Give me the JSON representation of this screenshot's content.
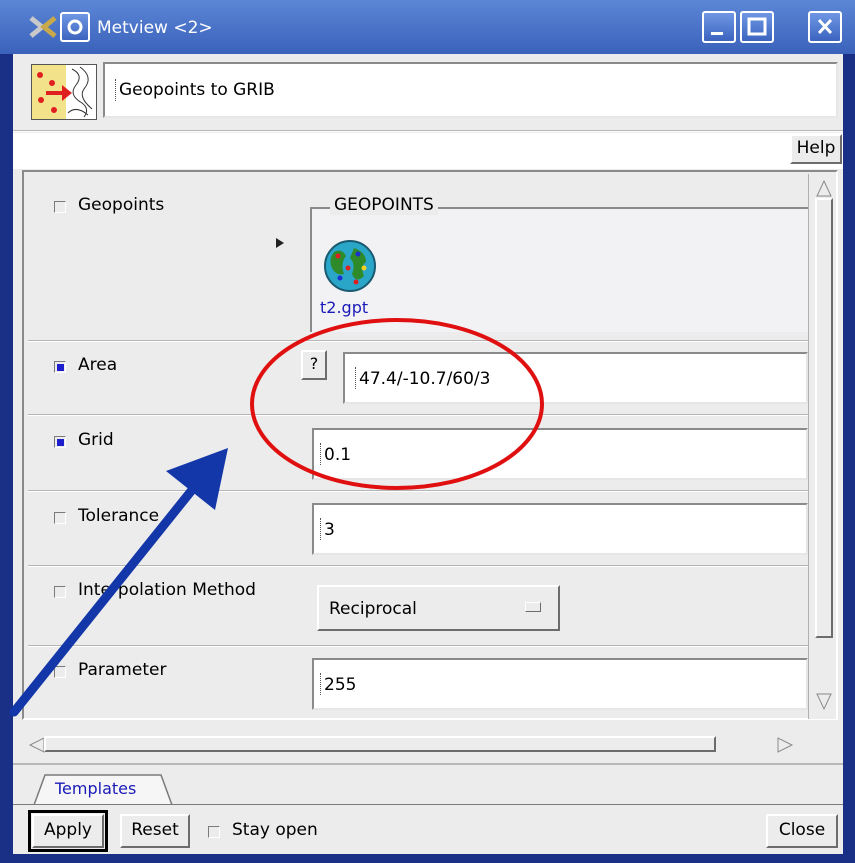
{
  "window": {
    "title": "Metview <2>",
    "colors": {
      "titlebar": "#4a74c9",
      "frame": "#1a2f86",
      "panel": "#ececec",
      "annotation_circle": "#e01010",
      "annotation_arrow": "#1336a8"
    }
  },
  "header": {
    "icon": "geo-to-grib-icon",
    "field_value": "Geopoints to GRIB"
  },
  "toolbar": {
    "help_label": "Help"
  },
  "params": {
    "geopoints": {
      "label": "Geopoints",
      "checked": false,
      "group_title": "GEOPOINTS",
      "file_name": "t2.gpt"
    },
    "area": {
      "label": "Area",
      "checked": true,
      "help_label": "?",
      "value": "47.4/-10.7/60/3"
    },
    "grid": {
      "label": "Grid",
      "checked": true,
      "value": "0.1"
    },
    "tolerance": {
      "label": "Tolerance",
      "checked": false,
      "value": "3"
    },
    "interpolation": {
      "label": "Interpolation Method",
      "checked": false,
      "selected": "Reciprocal"
    },
    "parameter": {
      "label": "Parameter",
      "checked": false,
      "value": "255"
    }
  },
  "tabs": [
    {
      "label": "Templates",
      "active": true
    }
  ],
  "footer": {
    "apply_label": "Apply",
    "reset_label": "Reset",
    "stay_open_label": "Stay open",
    "close_label": "Close"
  }
}
